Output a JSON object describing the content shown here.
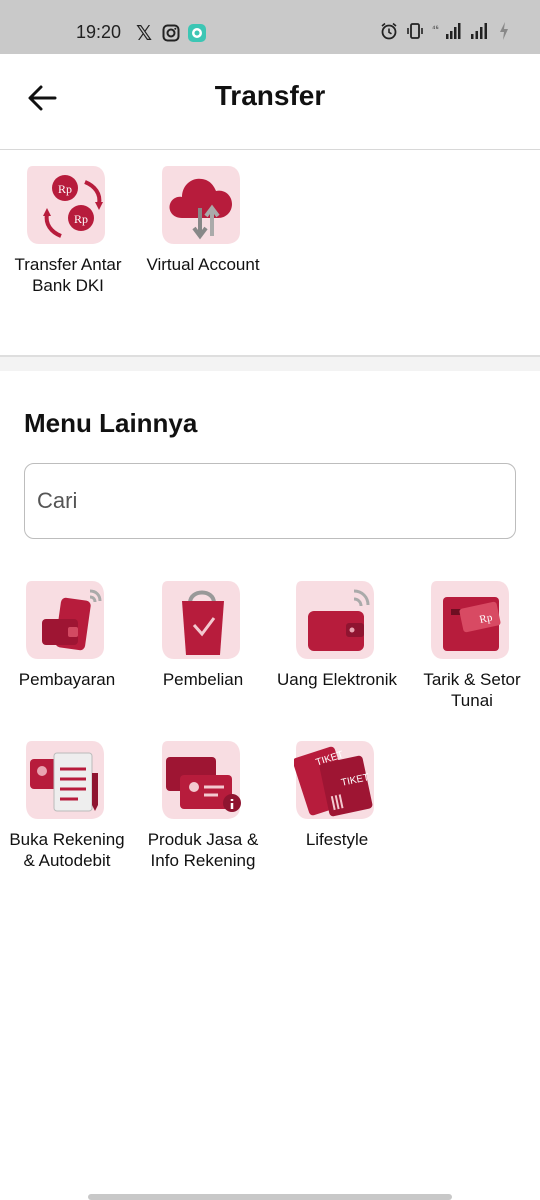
{
  "status_bar": {
    "time": "19:20"
  },
  "header": {
    "title": "Transfer"
  },
  "transfer_items": [
    {
      "label": "Transfer Antar\nBank DKI",
      "icon": "rp-exchange-icon"
    },
    {
      "label": "Virtual Account",
      "icon": "cloud-transfer-icon"
    }
  ],
  "menu": {
    "title": "Menu Lainnya",
    "search_placeholder": "Cari",
    "items": [
      {
        "label": "Pembayaran",
        "icon": "phone-wallet-icon"
      },
      {
        "label": "Pembelian",
        "icon": "shopping-bag-icon"
      },
      {
        "label": "Uang Elektronik",
        "icon": "e-wallet-icon"
      },
      {
        "label": "Tarik & Setor\nTunai",
        "icon": "atm-cash-icon"
      },
      {
        "label": "Buka Rekening\n& Autodebit",
        "icon": "document-card-icon"
      },
      {
        "label": "Produk Jasa &\nInfo Rekening",
        "icon": "info-card-icon"
      },
      {
        "label": "Lifestyle",
        "icon": "ticket-icon"
      }
    ]
  },
  "colors": {
    "accent": "#b71c3c",
    "accent_light": "#f7d6dc",
    "text": "#111111"
  }
}
